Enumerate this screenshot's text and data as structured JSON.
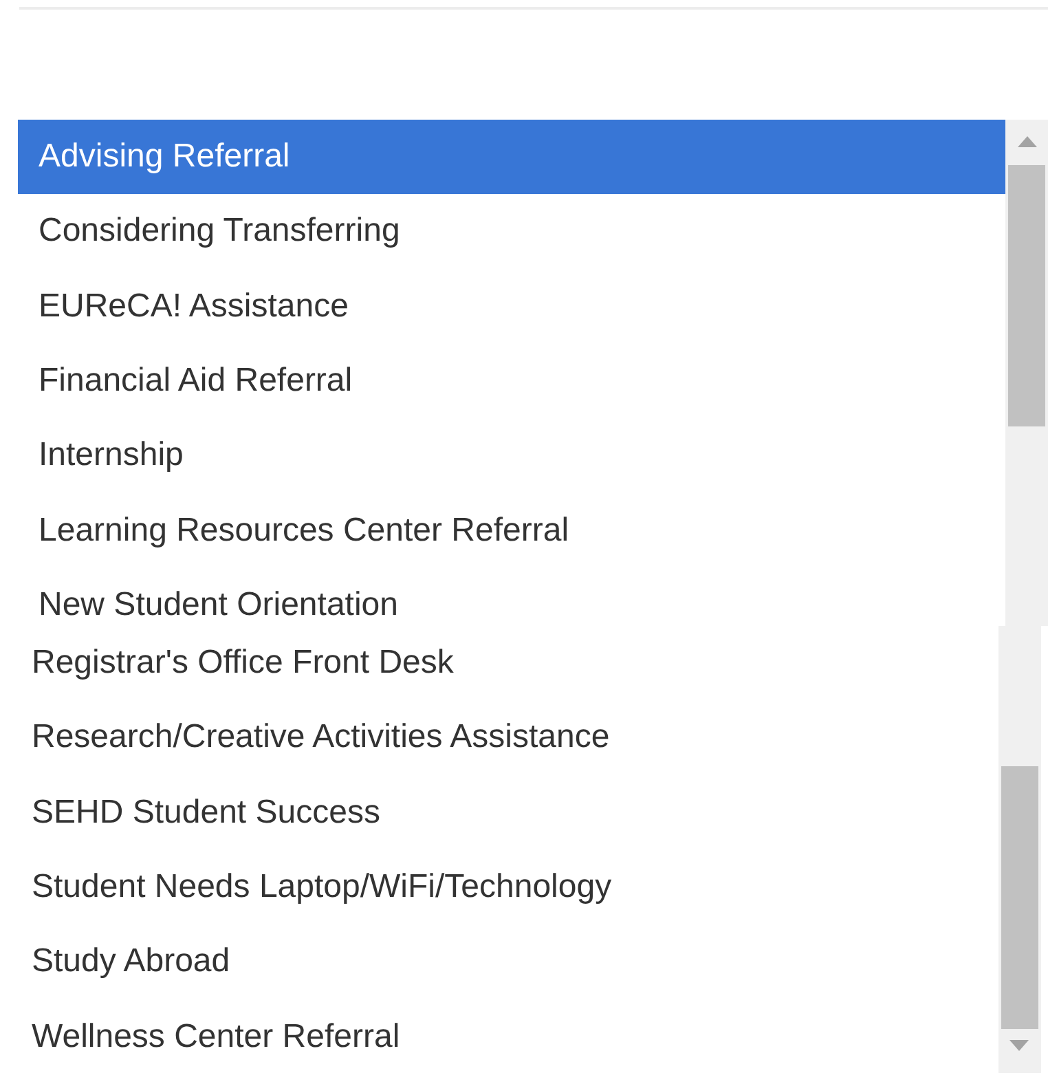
{
  "lists": [
    {
      "items": [
        {
          "label": "Advising Referral",
          "selected": true
        },
        {
          "label": "Considering Transferring",
          "selected": false
        },
        {
          "label": "EUReCA! Assistance",
          "selected": false
        },
        {
          "label": "Financial Aid Referral",
          "selected": false
        },
        {
          "label": "Internship",
          "selected": false
        },
        {
          "label": "Learning Resources Center Referral",
          "selected": false
        },
        {
          "label": "New Student Orientation",
          "selected": false
        }
      ]
    },
    {
      "items": [
        {
          "label": "Registrar's Office Front Desk",
          "selected": false
        },
        {
          "label": "Research/Creative Activities Assistance",
          "selected": false
        },
        {
          "label": "SEHD Student Success",
          "selected": false
        },
        {
          "label": "Student Needs Laptop/WiFi/Technology",
          "selected": false
        },
        {
          "label": "Study Abroad",
          "selected": false
        },
        {
          "label": "Wellness Center Referral",
          "selected": false
        }
      ]
    }
  ]
}
